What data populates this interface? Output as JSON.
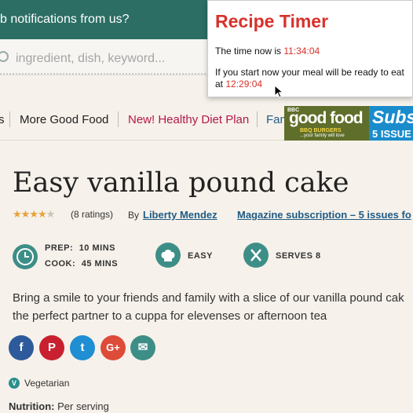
{
  "notification": {
    "text": "b notifications from us?"
  },
  "search": {
    "placeholder": "ingredient, dish, keyword..."
  },
  "nav": {
    "items": [
      {
        "label": "s",
        "color": "#222222"
      },
      {
        "label": "More Good Food",
        "color": "#222222"
      },
      {
        "label": "New! Healthy Diet Plan",
        "color": "#b5174b"
      },
      {
        "label": "Fam",
        "color": "#1f5b86"
      }
    ]
  },
  "ad": {
    "bbc": "BBC",
    "brand": "good food",
    "headline": "BBQ BURGERS",
    "tagline": "...your family will love",
    "right_title": "Subs",
    "right_sub": "5 ISSUE"
  },
  "recipe": {
    "title": "Easy vanilla pound cake",
    "rating": {
      "stars": 4,
      "max": 5,
      "count_text": "(8 ratings)"
    },
    "by_label": "By",
    "author": "Liberty Mendez",
    "magazine_link": "Magazine subscription – 5 issues fo",
    "prep_label": "PREP:",
    "prep_value": "10 MINS",
    "cook_label": "COOK:",
    "cook_value": "45 MINS",
    "difficulty": "EASY",
    "serves": "SERVES 8",
    "description_line1": "Bring a smile to your friends and family with a slice of our vanilla pound cak",
    "description_line2": "the perfect partner to a cuppa for elevenses or afternoon tea",
    "veg_badge": "V",
    "veg_label": "Vegetarian",
    "nutrition_label": "Nutrition:",
    "nutrition_value": "Per serving"
  },
  "share": [
    {
      "name": "facebook",
      "glyph": "f",
      "color": "#2d5a9b"
    },
    {
      "name": "pinterest",
      "glyph": "P",
      "color": "#c8202f"
    },
    {
      "name": "twitter",
      "glyph": "t",
      "color": "#1f8ed2"
    },
    {
      "name": "google-plus",
      "glyph": "G+",
      "color": "#dd4b39"
    },
    {
      "name": "email",
      "glyph": "✉",
      "color": "#3d8e87"
    }
  ],
  "popup": {
    "title": "Recipe Timer",
    "now_label": "The time now is",
    "now_time": "11:34:04",
    "ready_label": "If you start now your meal will be ready to eat at",
    "ready_time": "12:29:04"
  }
}
